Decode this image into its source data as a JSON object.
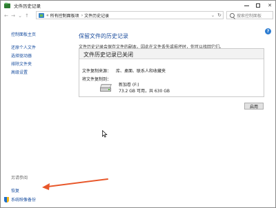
{
  "window": {
    "title": "文件历史记录"
  },
  "titlebar_controls": {
    "minimize": "minimize",
    "maximize": "maximize",
    "close": "✕"
  },
  "nav": {
    "back": "←",
    "forward": "→",
    "recent": "⌄",
    "up": "↑"
  },
  "address": {
    "separator": "«",
    "crumbs": [
      "所有控制面板项",
      "文件历史记录"
    ],
    "crumb_separator": "›",
    "dropdown": "⌄",
    "refresh": "↻"
  },
  "search": {
    "placeholder": "搜索控制面板"
  },
  "sidebar": {
    "items": [
      {
        "label": "控制面板主页"
      },
      {
        "label": "还原个人文件"
      },
      {
        "label": "选择驱动器"
      },
      {
        "label": "排除文件夹"
      },
      {
        "label": "高级设置"
      }
    ],
    "see_also_label": "另请参阅",
    "restore_label": "恢复",
    "system_image_label": "系统映像备份"
  },
  "main": {
    "heading": "保留文件的历史记录",
    "description": "文件历史记录会保存文件的副本，因此在文件丢失或损坏时，你可以找回它们。",
    "help_glyph": "?",
    "status_panel": {
      "title": "文件历史记录已关闭",
      "copy_from_label": "文件复制来源：",
      "copy_from_value": "库、桌面、联系人和收藏夹",
      "copy_to_label": "将文件复制到：",
      "drive_name": "新加卷 (F:)",
      "drive_space": "73.2 GB 可用，共 630 GB"
    },
    "enable_button": "启用"
  },
  "annotation": {
    "arrow_color": "#e8572a"
  }
}
